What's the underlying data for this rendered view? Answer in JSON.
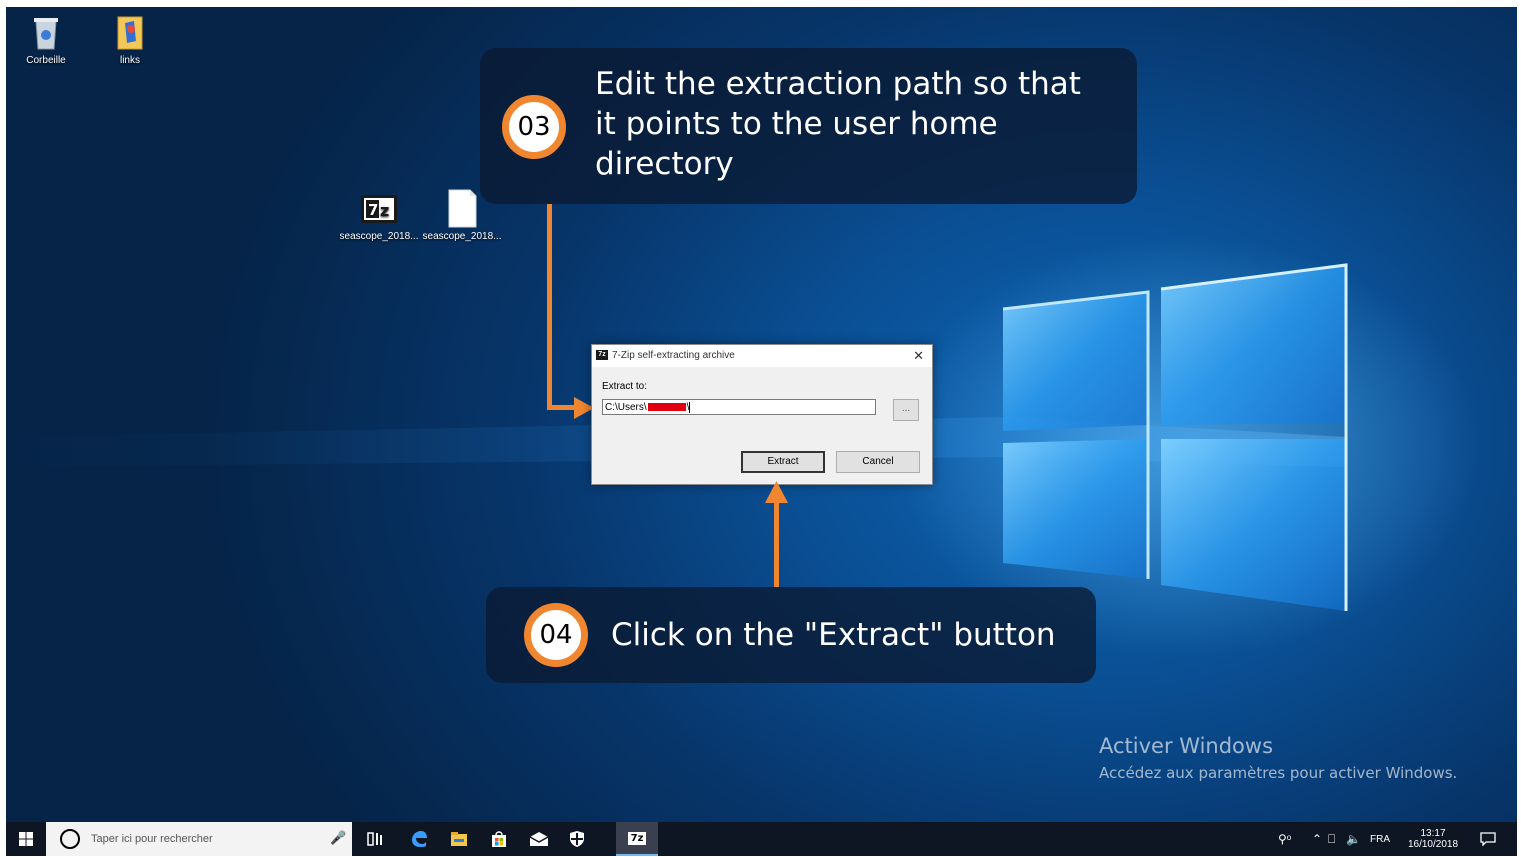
{
  "desktop": {
    "icons": [
      {
        "label": "Corbeille"
      },
      {
        "label": "links"
      },
      {
        "label": "seascope_2018..."
      },
      {
        "label": "seascope_2018..."
      }
    ]
  },
  "callouts": {
    "step3": {
      "number": "03",
      "line1": "Edit the extraction path so that",
      "line2": "it points to the user home",
      "line3": "directory"
    },
    "step4": {
      "number": "04",
      "text": "Click on the \"Extract\" button"
    }
  },
  "dialog": {
    "title": "7-Zip self-extracting archive",
    "icon_text": "7z",
    "close": "✕",
    "label": "Extract to:",
    "path_prefix": "C:\\Users\\",
    "path_suffix": "\\",
    "browse": "...",
    "extract": "Extract",
    "cancel": "Cancel"
  },
  "watermark": {
    "title": "Activer Windows",
    "subtitle": "Accédez aux paramètres pour activer Windows."
  },
  "taskbar": {
    "search_placeholder": "Taper ici pour rechercher",
    "tray_language": "FRA",
    "time": "13:17",
    "date": "16/10/2018",
    "sevenzip_label": "7z"
  },
  "colors": {
    "accent_orange": "#f0862f",
    "callout_bg": "#0a1932",
    "taskbar_bg": "#0f1623"
  }
}
